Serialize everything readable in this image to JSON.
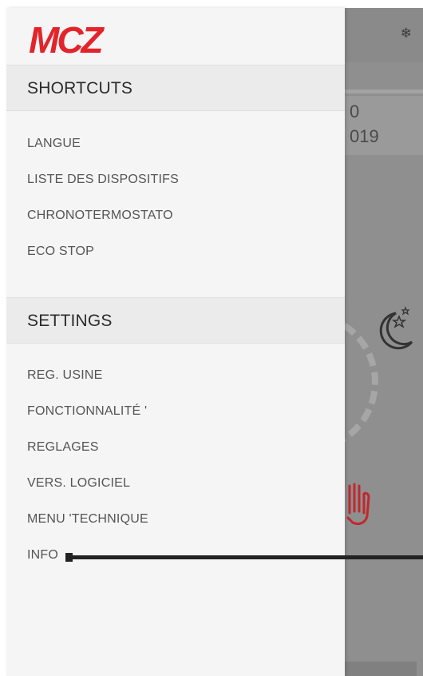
{
  "brand": {
    "logo_text": "MCZ",
    "logo_color": "#e3242b"
  },
  "background_app": {
    "top_icon": "snowflake-icon",
    "text_line_1": "0",
    "text_line_2": "019",
    "mode_icon": "moon-stars-icon",
    "manual_icon": "hand-icon"
  },
  "drawer": {
    "sections": [
      {
        "title": "SHORTCUTS",
        "items": [
          {
            "label": "LANGUE"
          },
          {
            "label": "LISTE DES DISPOSITIFS"
          },
          {
            "label": "CHRONOTERMOSTATO"
          },
          {
            "label": "ECO STOP"
          }
        ]
      },
      {
        "title": "SETTINGS",
        "items": [
          {
            "label": "REG. USINE"
          },
          {
            "label": "FONCTIONNALITÉ '"
          },
          {
            "label": "REGLAGES"
          },
          {
            "label": "VERS. LOGICIEL"
          },
          {
            "label": "MENU 'TECHNIQUE"
          },
          {
            "label": "INFO"
          }
        ]
      }
    ]
  },
  "colors": {
    "drawer_bg": "#f5f5f5",
    "header_bg": "#ebebeb",
    "overlay": "#8f8f8f",
    "accent_red": "#e3242b"
  }
}
